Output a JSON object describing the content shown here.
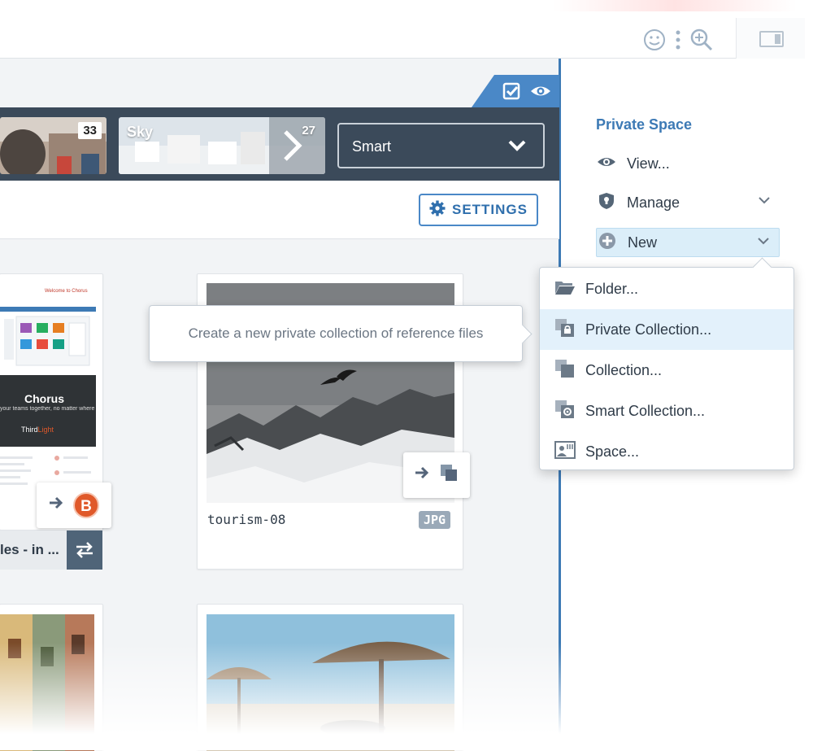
{
  "colors": {
    "accent": "#3d7ab5",
    "strip": "#3b4a5a",
    "highlight": "#e3f1fb",
    "brand_b": "#e0592a"
  },
  "topbar": {
    "icons": [
      "smiley-icon",
      "more-vertical-icon",
      "zoom-in-icon",
      "side-panel-toggle-icon"
    ]
  },
  "panel_tab": {
    "icons": [
      "checkbox-icon",
      "eye-icon"
    ]
  },
  "strip": {
    "thumbs": [
      {
        "label": "",
        "count": "33"
      },
      {
        "label": "Sky",
        "count": "27"
      }
    ],
    "select_value": "Smart"
  },
  "toolbar": {
    "settings_label": "SETTINGS"
  },
  "cards": [
    {
      "doc_heading": "Welcome to Chorus",
      "banner_title": "Chorus",
      "banner_sub": "your teams together, no matter where th",
      "logo_a": "Third",
      "logo_b": "Light",
      "brand_badge": "B",
      "collection_label": "les - in ..."
    },
    {
      "title": "tourism-08",
      "badge": "JPG"
    }
  ],
  "side": {
    "title": "Private Space",
    "items": [
      {
        "label": "View...",
        "icon": "eye-icon"
      },
      {
        "label": "Manage",
        "icon": "shield-icon"
      },
      {
        "label": "New",
        "icon": "plus-circle-icon"
      }
    ]
  },
  "dropdown": {
    "items": [
      {
        "label": "Folder...",
        "icon": "folder-icon"
      },
      {
        "label": "Private Collection...",
        "icon": "private-collection-icon"
      },
      {
        "label": "Collection...",
        "icon": "collection-icon"
      },
      {
        "label": "Smart Collection...",
        "icon": "smart-collection-icon"
      },
      {
        "label": "Space...",
        "icon": "space-icon"
      }
    ]
  },
  "tooltip": {
    "text": "Create a new private collection of reference files"
  }
}
